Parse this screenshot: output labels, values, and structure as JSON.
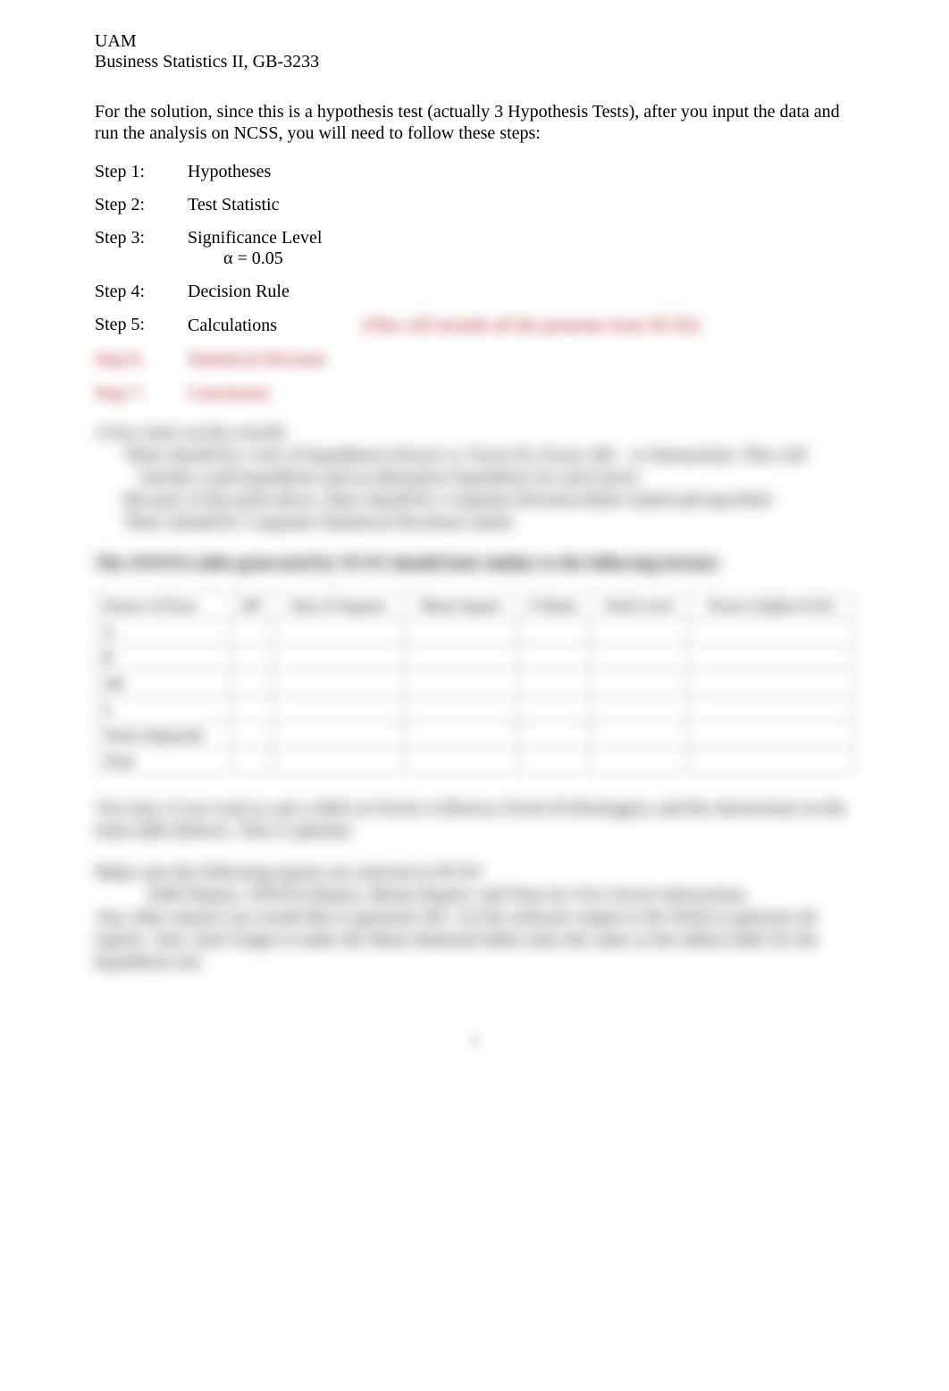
{
  "header": {
    "institution": "UAM",
    "course": "Business Statistics II, GB-3233"
  },
  "intro": "For the solution, since this is a hypothesis test (actually 3 Hypothesis Tests), after you input the data and run the analysis on NCSS, you will need to follow these steps:",
  "steps": [
    {
      "label": "Step 1:",
      "value": "Hypotheses"
    },
    {
      "label": "Step 2:",
      "value": "Test Statistic"
    },
    {
      "label": "Step 3:",
      "value": "Significance Level",
      "sub": "α  =  0.05"
    },
    {
      "label": "Step 4:",
      "value": "Decision Rule"
    },
    {
      "label": "Step 5:",
      "value": "Calculations",
      "note": "(This will include all the printouts from NCSS)"
    },
    {
      "label": "Step 6:",
      "value": "Statistical Decision"
    },
    {
      "label": "Step 7:",
      "value": "Conclusion"
    }
  ],
  "blocks": {
    "notes_title": "A few notes on the overall:",
    "notes": [
      "There should be 3 sets of hypotheses (Factor A, Factor B, Factor AB – or Interaction). This will include a null hypothesis and an alternative hypothesis for each factor.",
      "Because of the point above, there should be 3 separate Decision Rules stated and specified.",
      "There should be 3 separate Statistical Decisions stated."
    ],
    "table_heading": "The ANOVA table generated by NCSS should look similar to the following format:",
    "followup1": "You may, if you want to, put a label on Factor A (Rows), Factor B (Packages), and the interactions on the main table (below). This is optional.",
    "followup2_lead": "Make sure the following reports are selected in NCSS:",
    "followup2_list": "EMS Report, ANOVA Report, Means Report, and Tests for Two Factor Interactions.",
    "followup3": "Any other reports you would like to generate OK.  Let the software output to the Word or generate all reports.  Also, don't forget to make the Mean diamond tables (also the same as the tables) table for the hypothesis test."
  },
  "anova": {
    "headers": [
      "Source of Error",
      "DF",
      "Sum of Squares",
      "Mean Square",
      "F-Ratio",
      "Prob Level",
      "Power (Alpha=0.05)"
    ],
    "rows": [
      {
        "label": "A"
      },
      {
        "label": "B"
      },
      {
        "label": "AB"
      },
      {
        "label": "S"
      },
      {
        "label": "Total (Adjusted)"
      },
      {
        "label": "Total"
      }
    ]
  },
  "page_number": "2"
}
